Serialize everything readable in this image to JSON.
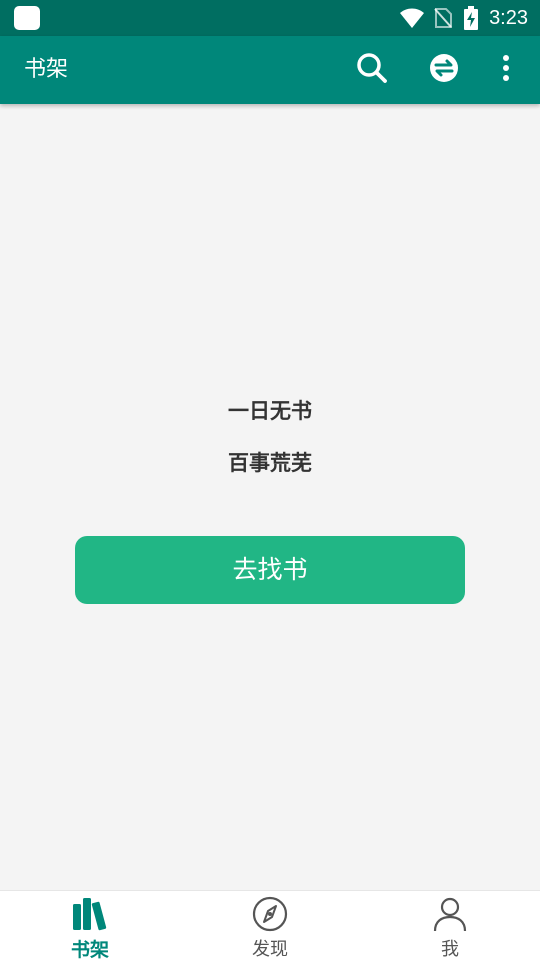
{
  "status_bar": {
    "time": "3:23"
  },
  "toolbar": {
    "title": "书架"
  },
  "empty_state": {
    "line1": "一日无书",
    "line2": "百事荒芜",
    "button_label": "去找书"
  },
  "bottom_nav": {
    "items": [
      {
        "label": "书架",
        "icon": "bookshelf-icon",
        "active": true
      },
      {
        "label": "发现",
        "icon": "compass-icon",
        "active": false
      },
      {
        "label": "我",
        "icon": "person-icon",
        "active": false
      }
    ]
  },
  "colors": {
    "status_bar": "#006e61",
    "toolbar": "#00877a",
    "accent_button": "#21b685",
    "active_nav": "#00877a",
    "background": "#f4f4f4"
  }
}
